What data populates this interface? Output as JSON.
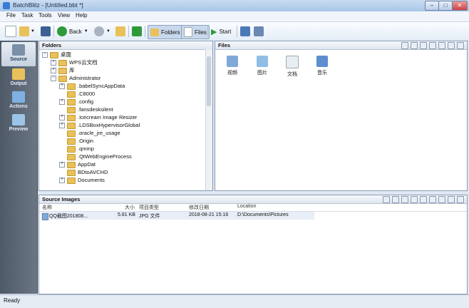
{
  "window": {
    "title": "BatchBlitz - [Untitled.bbt *]",
    "controls": {
      "minimize": "–",
      "maximize": "□",
      "close": "✕"
    }
  },
  "menu": {
    "items": [
      "File",
      "Task",
      "Tools",
      "View",
      "Help"
    ]
  },
  "toolbar": {
    "back_label": "Back",
    "folders_label": "Folders",
    "files_label": "Files",
    "start_label": "Start",
    "icons": [
      "new-document-icon",
      "open-folder-icon",
      "save-icon",
      "back-arrow-icon",
      "forward-arrow-icon",
      "up-folder-icon",
      "refresh-icon",
      "play-icon",
      "batch-icon",
      "settings-icon"
    ]
  },
  "sidebar": {
    "items": [
      {
        "label": "Source",
        "icon": "source-icon",
        "active": true
      },
      {
        "label": "Output",
        "icon": "output-icon",
        "active": false
      },
      {
        "label": "Actions",
        "icon": "actions-icon",
        "active": false
      },
      {
        "label": "Preview",
        "icon": "preview-icon",
        "active": false
      }
    ]
  },
  "folders": {
    "title": "Folders",
    "tree": [
      {
        "label": "桌面",
        "depth": 0,
        "expander": "−"
      },
      {
        "label": "WPS云文档",
        "depth": 1,
        "expander": "+"
      },
      {
        "label": "库",
        "depth": 1,
        "expander": "+"
      },
      {
        "label": "Administrator",
        "depth": 1,
        "expander": "−"
      },
      {
        "label": ".babelSyncAppData",
        "depth": 2,
        "expander": "+"
      },
      {
        "label": ".C8000",
        "depth": 2,
        "expander": ""
      },
      {
        "label": ".config",
        "depth": 2,
        "expander": "+"
      },
      {
        "label": ".fansdesksilent",
        "depth": 2,
        "expander": ""
      },
      {
        "label": ".Icecream Image Resizer",
        "depth": 2,
        "expander": "+"
      },
      {
        "label": ".LDSBoxHypervisorGlobal",
        "depth": 2,
        "expander": "+"
      },
      {
        "label": ".oracle_jre_usage",
        "depth": 2,
        "expander": ""
      },
      {
        "label": ".Origin",
        "depth": 2,
        "expander": ""
      },
      {
        "label": ".qmmp",
        "depth": 2,
        "expander": ""
      },
      {
        "label": ".QtWebEngineProcess",
        "depth": 2,
        "expander": ""
      },
      {
        "label": "AppDat",
        "depth": 2,
        "expander": "+"
      },
      {
        "label": "BDtoAVCHD",
        "depth": 2,
        "expander": ""
      },
      {
        "label": "Documents",
        "depth": 2,
        "expander": "+"
      }
    ]
  },
  "files": {
    "title": "Files",
    "items": [
      {
        "label": "视频",
        "icon": "video-folder-icon"
      },
      {
        "label": "图片",
        "icon": "pictures-folder-icon"
      },
      {
        "label": "文档",
        "icon": "documents-folder-icon"
      },
      {
        "label": "音乐",
        "icon": "music-folder-icon"
      }
    ]
  },
  "source_images": {
    "title": "Source Images",
    "columns": [
      "名称",
      "大小",
      "项目类型",
      "修改日期",
      "Location"
    ],
    "rows": [
      {
        "name": "QQ截图201808...",
        "size": "5.81 KB",
        "type": "JPG 文件",
        "modified": "2018-08-21 15:16",
        "location": "D:\\Documents\\Pictures"
      }
    ]
  },
  "status": {
    "text": "Ready"
  },
  "colors": {
    "accent": "#3a7bd5",
    "folder": "#e9c15a",
    "sidebar": "#5b6673"
  }
}
